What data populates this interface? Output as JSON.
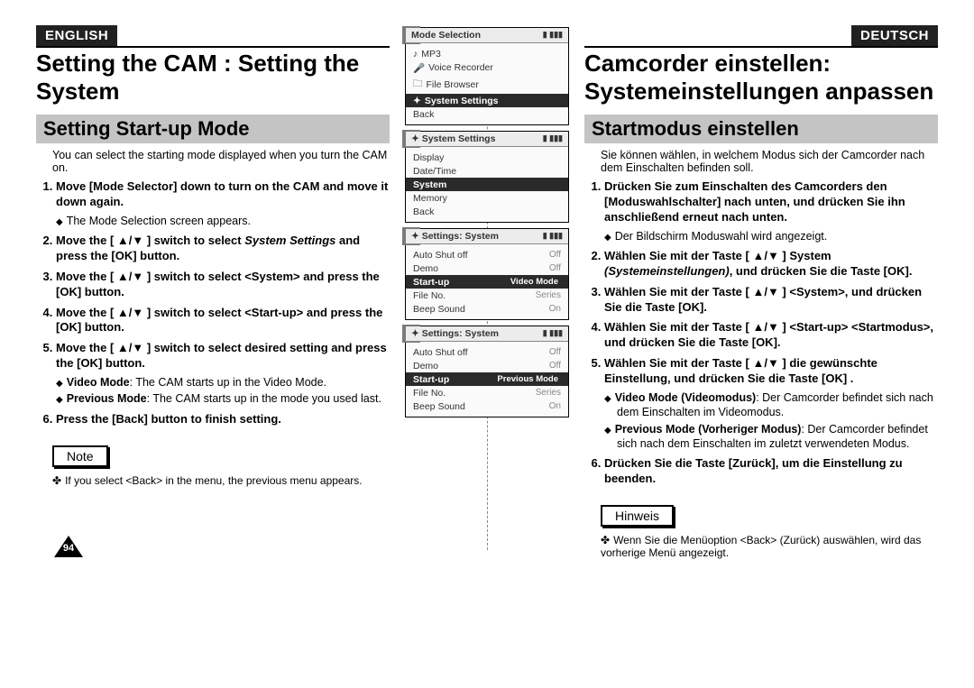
{
  "en": {
    "langTab": "ENGLISH",
    "bigTitle": "Setting the CAM : Setting the System",
    "section": "Setting Start-up Mode",
    "intro": "You can select the starting mode displayed when you turn the CAM on.",
    "step1": "Move [Mode Selector] down to turn on the CAM and move it down again.",
    "step1sub": "The Mode Selection screen appears.",
    "step2a": "Move the [ ▲/▼ ] switch to select ",
    "step2b": "System Settings",
    "step2c": " and press the [OK] button.",
    "step3": "Move the [ ▲/▼ ] switch to select <System> and press the [OK] button.",
    "step4": "Move the [ ▲/▼ ] switch to select <Start-up> and press the [OK] button.",
    "step5": "Move the [ ▲/▼ ] switch to select desired setting and press the [OK] button.",
    "step5subA_b": "Video Mode",
    "step5subA_t": ": The CAM starts up in the Video Mode.",
    "step5subB_b": "Previous Mode",
    "step5subB_t": ": The CAM starts up in the mode you used last.",
    "step6": "Press the [Back] button to finish setting.",
    "noteLabel": "Note",
    "noteText": "If you select <Back> in the menu, the previous menu appears."
  },
  "de": {
    "langTab": "DEUTSCH",
    "bigTitle1": "Camcorder einstellen:",
    "bigTitle2": "Systemeinstellungen anpassen",
    "section": "Startmodus einstellen",
    "intro": "Sie können wählen, in welchem Modus sich der Camcorder nach dem Einschalten befinden soll.",
    "step1": "Drücken Sie zum Einschalten des Camcorders den [Moduswahlschalter] nach unten, und drücken Sie ihn anschließend erneut nach unten.",
    "step1sub": "Der Bildschirm Moduswahl wird angezeigt.",
    "step2a": "Wählen Sie mit der Taste [ ▲/▼ ] System ",
    "step2b": "(Systemeinstellungen)",
    "step2c": ", und drücken Sie die Taste [OK].",
    "step3": "Wählen Sie mit der Taste [ ▲/▼ ] <System>, und drücken Sie die Taste [OK].",
    "step4": "Wählen Sie mit der Taste [ ▲/▼ ] <Start-up> <Startmodus>, und drücken Sie die Taste [OK].",
    "step5": "Wählen Sie mit der Taste [ ▲/▼ ] die gewünschte Einstellung, und drücken Sie die Taste [OK] .",
    "step5subA_b": "Video Mode (Videomodus)",
    "step5subA_t": ": Der Camcorder befindet sich nach dem Einschalten im Videomodus.",
    "step5subB_b": "Previous Mode (Vorheriger Modus)",
    "step5subB_t": ": Der Camcorder befindet sich nach dem Einschalten im zuletzt verwendeten Modus.",
    "step6": "Drücken Sie die Taste [Zurück], um die Einstellung zu beenden.",
    "noteLabel": "Hinweis",
    "noteText": "Wenn Sie die Menüoption <Back> (Zurück) auswählen, wird das vorherige Menü angezeigt."
  },
  "screens": {
    "s2": {
      "title": "Mode Selection",
      "items": [
        "MP3",
        "Voice Recorder",
        "File Browser"
      ],
      "hl": "System Settings",
      "back": "Back"
    },
    "s3": {
      "title": "System Settings",
      "items": [
        "Display",
        "Date/Time"
      ],
      "hl": "System",
      "items2": [
        "Memory",
        "Back"
      ]
    },
    "s4": {
      "title": "Settings: System",
      "rows": [
        [
          "Auto Shut off",
          "Off"
        ],
        [
          "Demo",
          "Off"
        ]
      ],
      "hl": [
        "Start-up",
        "Video Mode"
      ],
      "rows2": [
        [
          "File No.",
          "Series"
        ],
        [
          "Beep Sound",
          "On"
        ]
      ]
    },
    "s5": {
      "title": "Settings: System",
      "rows": [
        [
          "Auto Shut off",
          "Off"
        ],
        [
          "Demo",
          "Off"
        ]
      ],
      "hl": [
        "Start-up",
        "Previous Mode"
      ],
      "rows2": [
        [
          "File No.",
          "Series"
        ],
        [
          "Beep Sound",
          "On"
        ]
      ]
    },
    "icons": "▮ ▮▮▮"
  },
  "pageNumber": "94"
}
